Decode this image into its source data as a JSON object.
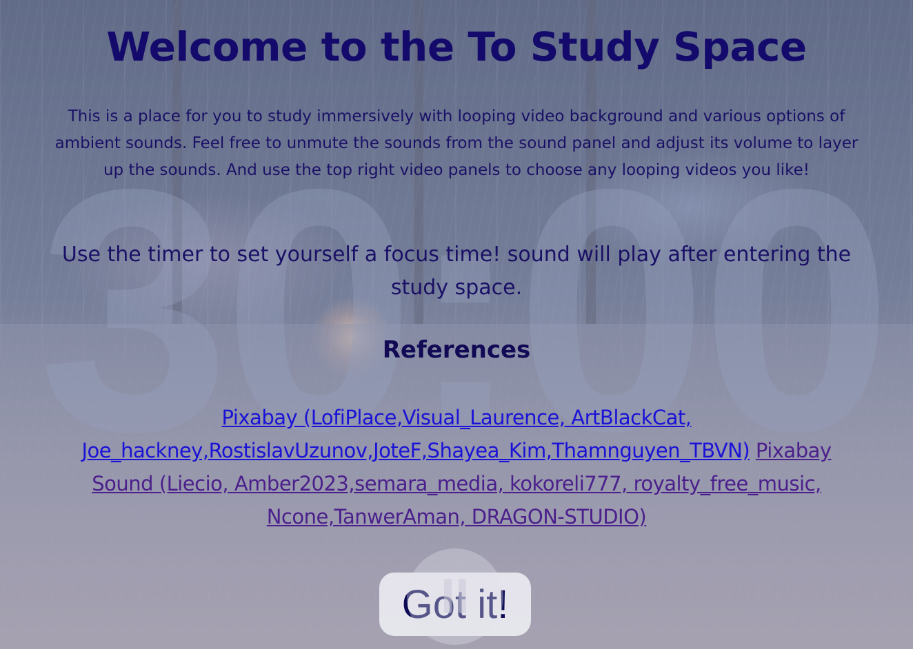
{
  "timer": {
    "display": "30:00"
  },
  "welcome": {
    "title": "Welcome to the To Study Space",
    "intro": "This is a place for you to study immersively with looping video background and various options of ambient sounds. Feel free to unmute the sounds from the sound panel and adjust its volume to layer up the sounds. And use the top right video panels to choose any looping videos you like!",
    "timer_note": "Use the timer to set yourself a focus time! sound will play after entering the study space."
  },
  "references": {
    "heading": "References",
    "video_link": "Pixabay (LofiPlace,Visual_Laurence, ArtBlackCat, Joe_hackney,RostislavUzunov,JoteF,Shayea_Kim,Thamnguyen_TBVN)",
    "sound_link": "Pixabay Sound (Liecio, Amber2023,semara_media, kokoreli777, royalty_free_music, Ncone,TanwerAman, DRAGON-STUDIO)"
  },
  "actions": {
    "got_it_label": "Got it!"
  },
  "icons": {
    "pause": "pause-icon"
  },
  "colors": {
    "title": "#140a6b",
    "body_text": "#1a1066",
    "video_link": "#1a12d6",
    "sound_link": "#4b1f8c",
    "button_bg": "#eeeef4"
  }
}
